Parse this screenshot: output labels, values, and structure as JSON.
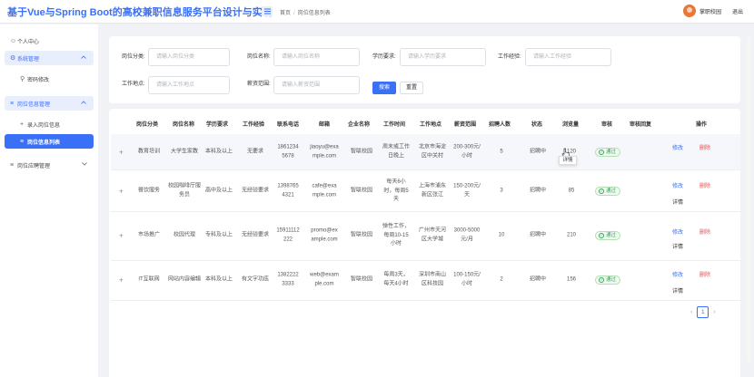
{
  "header": {
    "title": "基于Vue与Spring Boot的高校兼职信息服务平台设计与实现",
    "breadcrumb": [
      "首页",
      "岗位信息列表"
    ],
    "user_name": "掌职校园",
    "logout_label": "退出"
  },
  "sidebar": {
    "items": [
      {
        "label": "个人中心",
        "icon": "person-icon"
      },
      {
        "label": "系统管理",
        "icon": "gear-icon",
        "expanded": true
      },
      {
        "label": "密码修改",
        "icon": "key-icon"
      },
      {
        "label": "岗位信息管理",
        "icon": "list-icon",
        "expanded": true
      },
      {
        "label": "录入岗位信息",
        "icon": "plus-icon"
      },
      {
        "label": "岗位信息列表",
        "icon": "list-icon",
        "active": true
      },
      {
        "label": "岗位应聘管理",
        "icon": "list-icon",
        "expanded": false
      }
    ]
  },
  "search": {
    "category_label": "岗位分类:",
    "category_placeholder": "请输入岗位分类",
    "name_label": "岗位名称:",
    "name_placeholder": "请输入岗位名称",
    "edu_label": "学历要求:",
    "edu_placeholder": "请输入学历要求",
    "exp_label": "工作经验:",
    "exp_placeholder": "请输入工作经验",
    "location_label": "工作地点:",
    "location_placeholder": "请输入工作地点",
    "salary_label": "薪资范围:",
    "salary_placeholder": "请输入薪资范围",
    "search_button": "搜索",
    "reset_button": "重置"
  },
  "table": {
    "headers": [
      "岗位分类",
      "岗位名称",
      "学历要求",
      "工作经验",
      "联系电话",
      "邮箱",
      "企业名称",
      "工作时间",
      "工作地点",
      "薪资范围",
      "招聘人数",
      "状态",
      "浏览量",
      "审核",
      "审核回复",
      "操作"
    ],
    "rows": [
      {
        "category": "教育培训",
        "name": "大学生家教",
        "edu": "本科及以上",
        "exp": "无要求",
        "phone": "18612345678",
        "email": "jiaoyu@example.com",
        "company": "智联校园",
        "time": "周末或工作日晚上",
        "location": "北京市海淀区中关村",
        "salary": "200-300元/小时",
        "count": "5",
        "status": "招聘中",
        "views": "120",
        "audit": "通过",
        "reply": ""
      },
      {
        "category": "餐饮服务",
        "name": "校园咖啡厅服务员",
        "edu": "高中及以上",
        "exp": "无经验要求",
        "phone": "13987654321",
        "email": "cafe@example.com",
        "company": "智联校园",
        "time": "每天6小时，每周5天",
        "location": "上海市浦东新区张江",
        "salary": "150-200元/天",
        "count": "3",
        "status": "招聘中",
        "views": "85",
        "audit": "通过",
        "reply": ""
      },
      {
        "category": "市场推广",
        "name": "校园代理",
        "edu": "专科及以上",
        "exp": "无经验要求",
        "phone": "15911112222",
        "email": "promo@example.com",
        "company": "智联校园",
        "time": "弹性工作，每周10-15小时",
        "location": "广州市天河区大学城",
        "salary": "3000-5000元/月",
        "count": "10",
        "status": "招聘中",
        "views": "210",
        "audit": "通过",
        "reply": ""
      },
      {
        "category": "IT互联网",
        "name": "网站内容编辑",
        "edu": "本科及以上",
        "exp": "有文字功底",
        "phone": "13822223333",
        "email": "web@example.com",
        "company": "智联校园",
        "time": "每周3天，每天4小时",
        "location": "深圳市南山区科技园",
        "salary": "100-150元/小时",
        "count": "2",
        "status": "招聘中",
        "views": "156",
        "audit": "通过",
        "reply": ""
      }
    ],
    "actions": {
      "edit": "修改",
      "delete": "删除",
      "detail": "详情"
    },
    "tooltip": "详情"
  },
  "pagination": {
    "current_page": "1",
    "prev_icon": "chevron-left-icon",
    "next_icon": "chevron-right-icon"
  },
  "colors": {
    "primary": "#3a6ff7",
    "danger": "#e55353",
    "success": "#3ba55c"
  }
}
